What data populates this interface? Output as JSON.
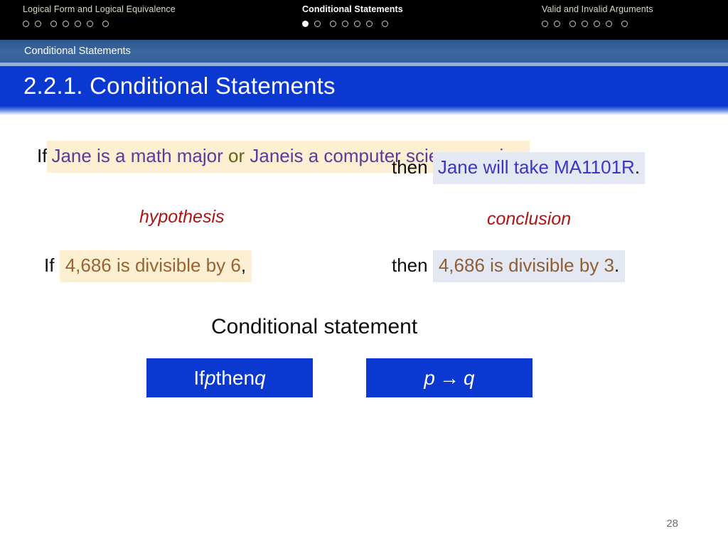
{
  "nav": {
    "groups": [
      {
        "label": "Logical Form and Logical Equivalence",
        "dots": 7,
        "active_index": -1
      },
      {
        "label": "Conditional Statements",
        "dots": 7,
        "active_index": 0
      },
      {
        "label": "Valid and Invalid Arguments",
        "dots": 7,
        "active_index": -1
      }
    ]
  },
  "section": {
    "label": "Conditional Statements"
  },
  "title": {
    "text": "2.2.1. Conditional Statements"
  },
  "examples": [
    {
      "hypothesis": {
        "if_keyword": "If",
        "line1_part1": "Jane is a math major ",
        "line1_connective": "or",
        "line1_part2": " Jane",
        "line2": "is a computer science major",
        "comma": ",",
        "highlight_color": "#fdf0d2",
        "text_color": "#5a3a9e",
        "connective_color": "#6f5f14"
      },
      "conclusion": {
        "then_keyword": "then",
        "text": "Jane will take MA1101R",
        "period": ".",
        "highlight_color": "#e4e8f3",
        "text_color": "#3b36c6"
      }
    },
    {
      "hypothesis": {
        "if_keyword": "If",
        "text": "4,686 is divisible by 6",
        "comma": ",",
        "highlight_color": "#fdf0d2",
        "text_color": "#9a6330"
      },
      "conclusion": {
        "then_keyword": "then",
        "text": "4,686 is divisible by 3",
        "period": ".",
        "highlight_color": "#e4e8f3",
        "text_color": "#8f5f33"
      }
    }
  ],
  "role_labels": {
    "hypothesis": "hypothesis",
    "conclusion": "conclusion",
    "color": "#b11212"
  },
  "caption": {
    "text": "Conditional statement"
  },
  "formula_boxes": [
    {
      "prefix": "If ",
      "var1": "p",
      "middle": " then ",
      "var2": "q",
      "suffix": "",
      "background": "#0b38d0"
    },
    {
      "prefix": "",
      "var1": "p",
      "middle": "→",
      "var2": "q",
      "suffix": "",
      "background": "#0b38d0"
    }
  ],
  "footer": {
    "page_number": "28"
  },
  "colors": {
    "navbar_bg": "#000000",
    "section_bg": "#36609a",
    "title_bg": "#0b38d0",
    "rule": "#8fb0dd"
  }
}
